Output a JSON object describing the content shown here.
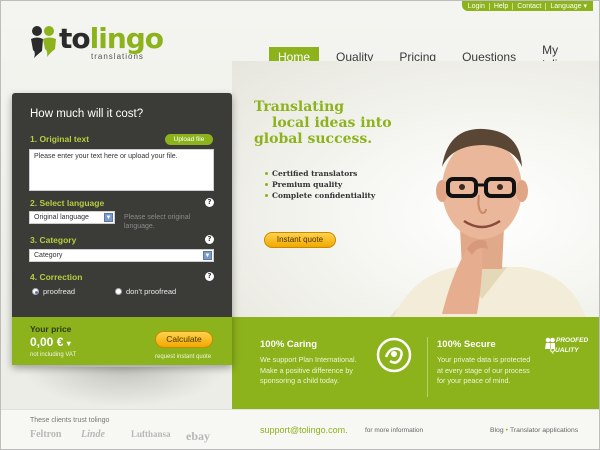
{
  "utility_links": [
    "Login",
    "Help",
    "Contact",
    "Language"
  ],
  "logo": {
    "word_part1": "to",
    "word_part2": "lingo",
    "subtitle": "translations"
  },
  "nav": [
    {
      "label": "Home",
      "active": true
    },
    {
      "label": "Quality",
      "active": false
    },
    {
      "label": "Pricing",
      "active": false
    },
    {
      "label": "Questions",
      "active": false
    },
    {
      "label": "My tolingo",
      "active": false
    }
  ],
  "calculator": {
    "title": "How much will it cost?",
    "section1": "1. Original text",
    "upload_label": "Upload file",
    "text_placeholder": "Please enter your text here or upload your file.",
    "section2": "2. Select language",
    "language_value": "Original language",
    "language_hint": "Please select original language.",
    "section3": "3. Category",
    "category_value": "Category",
    "section4": "4. Correction",
    "correction_options": [
      "proofread",
      "don't proofread"
    ],
    "correction_selected": "proofread",
    "price_label": "Your price",
    "price_value": "0,00 €",
    "price_note": "not including VAT",
    "calculate_label": "Calculate",
    "calculate_note": "request instant quote"
  },
  "hero": {
    "tagline_1": "Translating",
    "tagline_2": "local ideas into",
    "tagline_3": "global success.",
    "features": [
      "Certified translators",
      "Premium quality",
      "Complete confidentiality"
    ],
    "quote_button": "Instant quote"
  },
  "band": {
    "caring_title": "100% Caring",
    "caring_text": [
      "We support Plan International.",
      "Make a positive difference by",
      "sponsoring a child today."
    ],
    "secure_title": "100% Secure",
    "secure_text": [
      "Your private data is protected",
      "at every stage of our process",
      "for your peace of mind."
    ],
    "badge_text": [
      "PROOFED",
      "QUALITY"
    ]
  },
  "footer": {
    "clients_title": "These clients trust tolingo",
    "clients": [
      "Feltron",
      "Linde",
      "Lufthansa",
      "ebay"
    ],
    "email": "support@tolingo.com.",
    "email_note": "for more information",
    "links": [
      "Blog",
      "Translator applications"
    ]
  },
  "colors": {
    "brand_green": "#8cb21c",
    "panel_dark": "#3b3b38",
    "button_orange": "#f0a800"
  }
}
